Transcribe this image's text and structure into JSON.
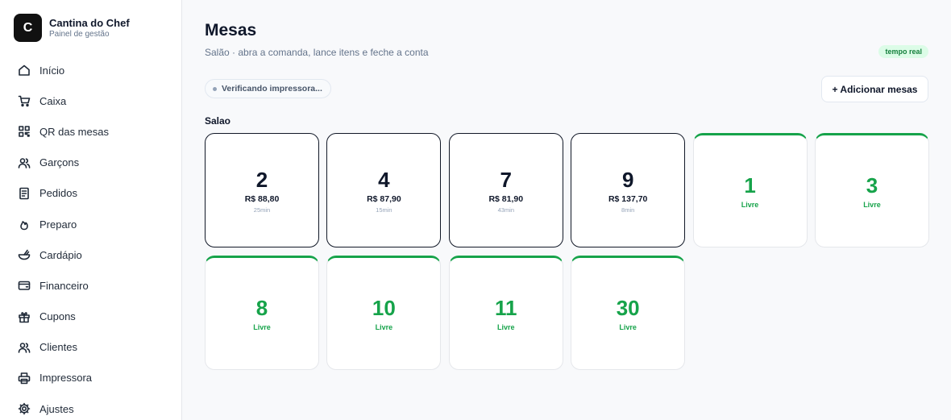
{
  "brand": {
    "initial": "C",
    "name": "Cantina do Chef",
    "subtitle": "Painel de gestão"
  },
  "nav": [
    {
      "label": "Início",
      "icon": "home-icon"
    },
    {
      "label": "Caixa",
      "icon": "cart-icon"
    },
    {
      "label": "QR das mesas",
      "icon": "qr-icon"
    },
    {
      "label": "Garçons",
      "icon": "users-icon"
    },
    {
      "label": "Pedidos",
      "icon": "document-icon"
    },
    {
      "label": "Preparo",
      "icon": "flame-icon"
    },
    {
      "label": "Cardápio",
      "icon": "bowl-icon"
    },
    {
      "label": "Financeiro",
      "icon": "wallet-icon"
    },
    {
      "label": "Cupons",
      "icon": "gift-icon"
    },
    {
      "label": "Clientes",
      "icon": "users-icon"
    },
    {
      "label": "Impressora",
      "icon": "printer-icon"
    },
    {
      "label": "Ajustes",
      "icon": "gear-icon"
    }
  ],
  "header": {
    "title": "Mesas",
    "subtitle": "Salão · abra a comanda, lance itens e feche a conta",
    "badge": "tempo real"
  },
  "printer_status": "Verificando impressora...",
  "add_button": "+ Adicionar mesas",
  "section": {
    "title": "Salao",
    "tables": [
      {
        "number": "2",
        "status": "busy",
        "amount": "R$ 88,80",
        "time": "25min"
      },
      {
        "number": "4",
        "status": "busy",
        "amount": "R$ 87,90",
        "time": "15min"
      },
      {
        "number": "7",
        "status": "busy",
        "amount": "R$ 81,90",
        "time": "43min"
      },
      {
        "number": "9",
        "status": "busy",
        "amount": "R$ 137,70",
        "time": "8min"
      },
      {
        "number": "1",
        "status": "free",
        "label": "Livre"
      },
      {
        "number": "3",
        "status": "free",
        "label": "Livre"
      },
      {
        "number": "8",
        "status": "free",
        "label": "Livre"
      },
      {
        "number": "10",
        "status": "free",
        "label": "Livre"
      },
      {
        "number": "11",
        "status": "free",
        "label": "Livre"
      },
      {
        "number": "30",
        "status": "free",
        "label": "Livre"
      }
    ]
  },
  "colors": {
    "accent_green": "#16a34a",
    "badge_bg": "#dcfce7",
    "dark": "#0f172a"
  }
}
